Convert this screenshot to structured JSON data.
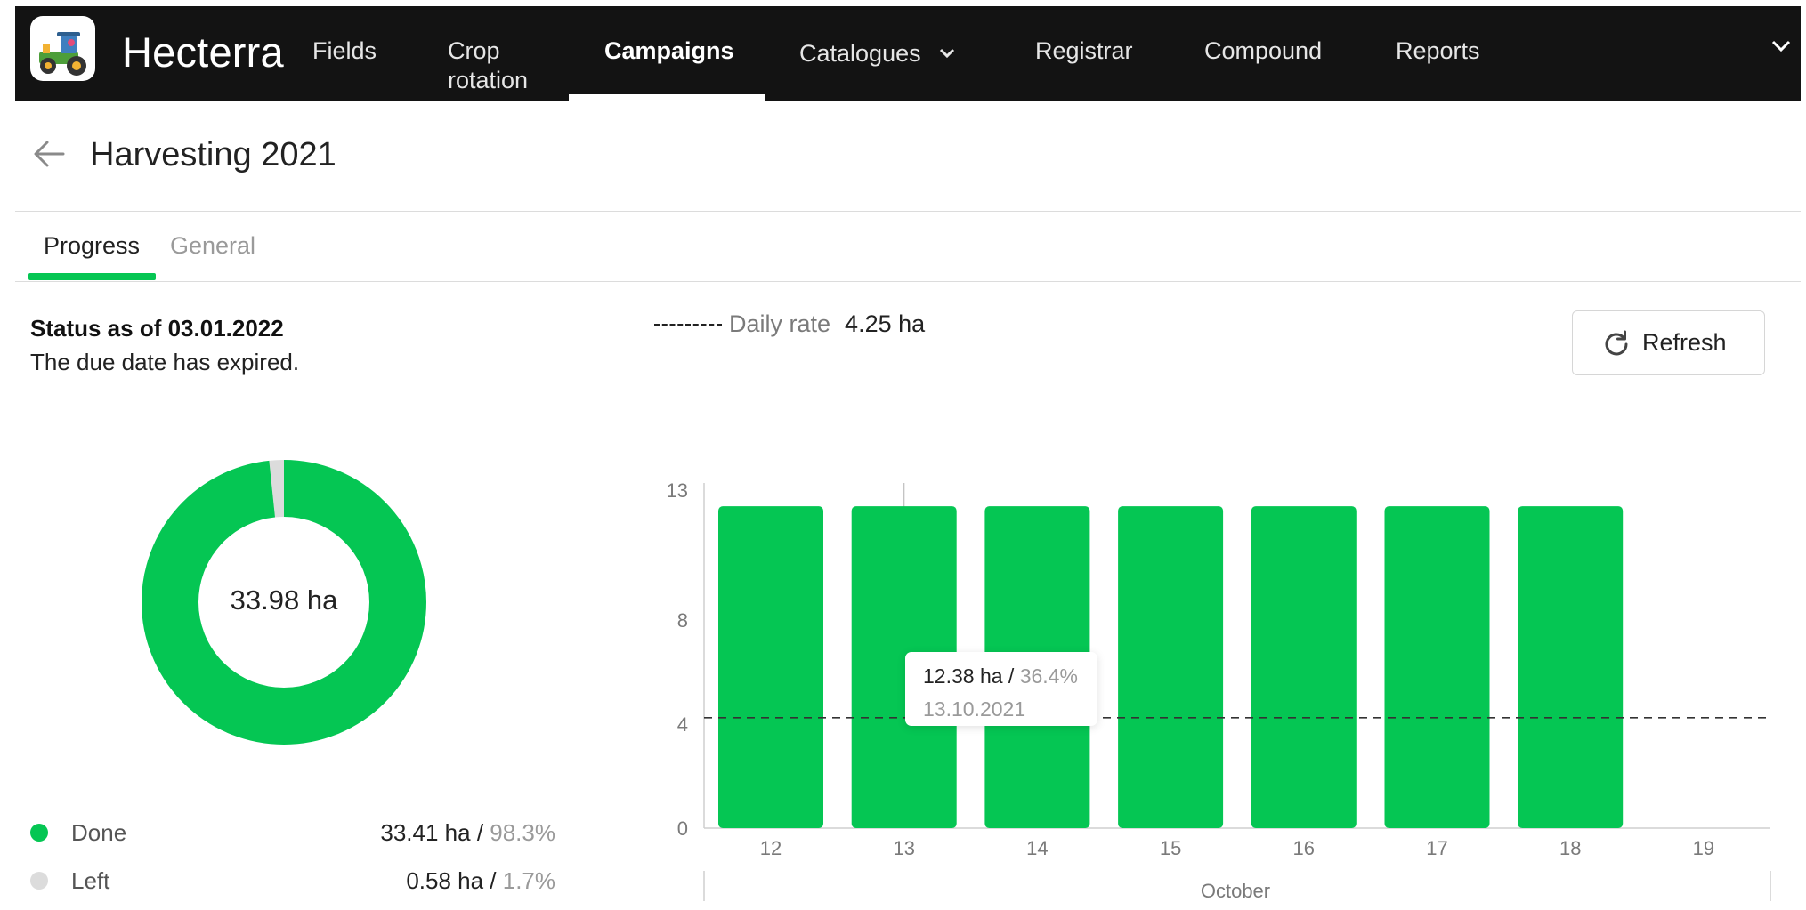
{
  "app": {
    "brand": "Hecterra",
    "logo_icon": "tractor-icon"
  },
  "nav": {
    "items": [
      {
        "label": "Fields"
      },
      {
        "label": "Crop\nrotation"
      },
      {
        "label": "Campaigns",
        "active": true
      },
      {
        "label": "Catalogues",
        "has_dropdown": true
      },
      {
        "label": "Registrar"
      },
      {
        "label": "Compound"
      },
      {
        "label": "Reports"
      }
    ],
    "overflow_icon": "chevron-down-icon"
  },
  "page": {
    "title": "Harvesting 2021",
    "back_icon": "arrow-left-icon"
  },
  "tabs": [
    {
      "label": "Progress",
      "active": true
    },
    {
      "label": "General",
      "active": false
    }
  ],
  "status": {
    "title": "Status as of 03.01.2022",
    "message": "The due date has expired."
  },
  "donut": {
    "center_label": "33.98 ha",
    "segments": [
      {
        "name": "Done",
        "fraction": 0.983,
        "color": "#05c653"
      },
      {
        "name": "Left",
        "fraction": 0.017,
        "color": "#dcdcdc"
      }
    ]
  },
  "legend": [
    {
      "label": "Done",
      "value": "33.41 ha",
      "sep": " / ",
      "pct": "98.3%",
      "color": "#05c653"
    },
    {
      "label": "Left",
      "value": "0.58 ha",
      "sep": " / ",
      "pct": "1.7%",
      "color": "#dcdcdc"
    }
  ],
  "daily_rate": {
    "label": "Daily rate",
    "value": "4.25 ha"
  },
  "refresh": {
    "label": "Refresh",
    "icon": "refresh-icon"
  },
  "tooltip": {
    "value": "12.38 ha",
    "sep": " / ",
    "pct": "36.4%",
    "date": "13.10.2021"
  },
  "colors": {
    "accent": "#05c653",
    "topbar": "#131313"
  },
  "chart_data": {
    "type": "bar",
    "categories": [
      "12",
      "13",
      "14",
      "15",
      "16",
      "17",
      "18",
      "19"
    ],
    "values": [
      12.38,
      12.38,
      12.38,
      12.38,
      12.38,
      12.38,
      12.38,
      0
    ],
    "y_ticks": [
      0,
      4,
      8,
      13
    ],
    "ylim": [
      0,
      13
    ],
    "x_group_label": "October",
    "reference_line": {
      "label": "Daily rate",
      "value": 4.25,
      "style": "dashed"
    },
    "bar_color": "#05c653",
    "grid": false
  }
}
